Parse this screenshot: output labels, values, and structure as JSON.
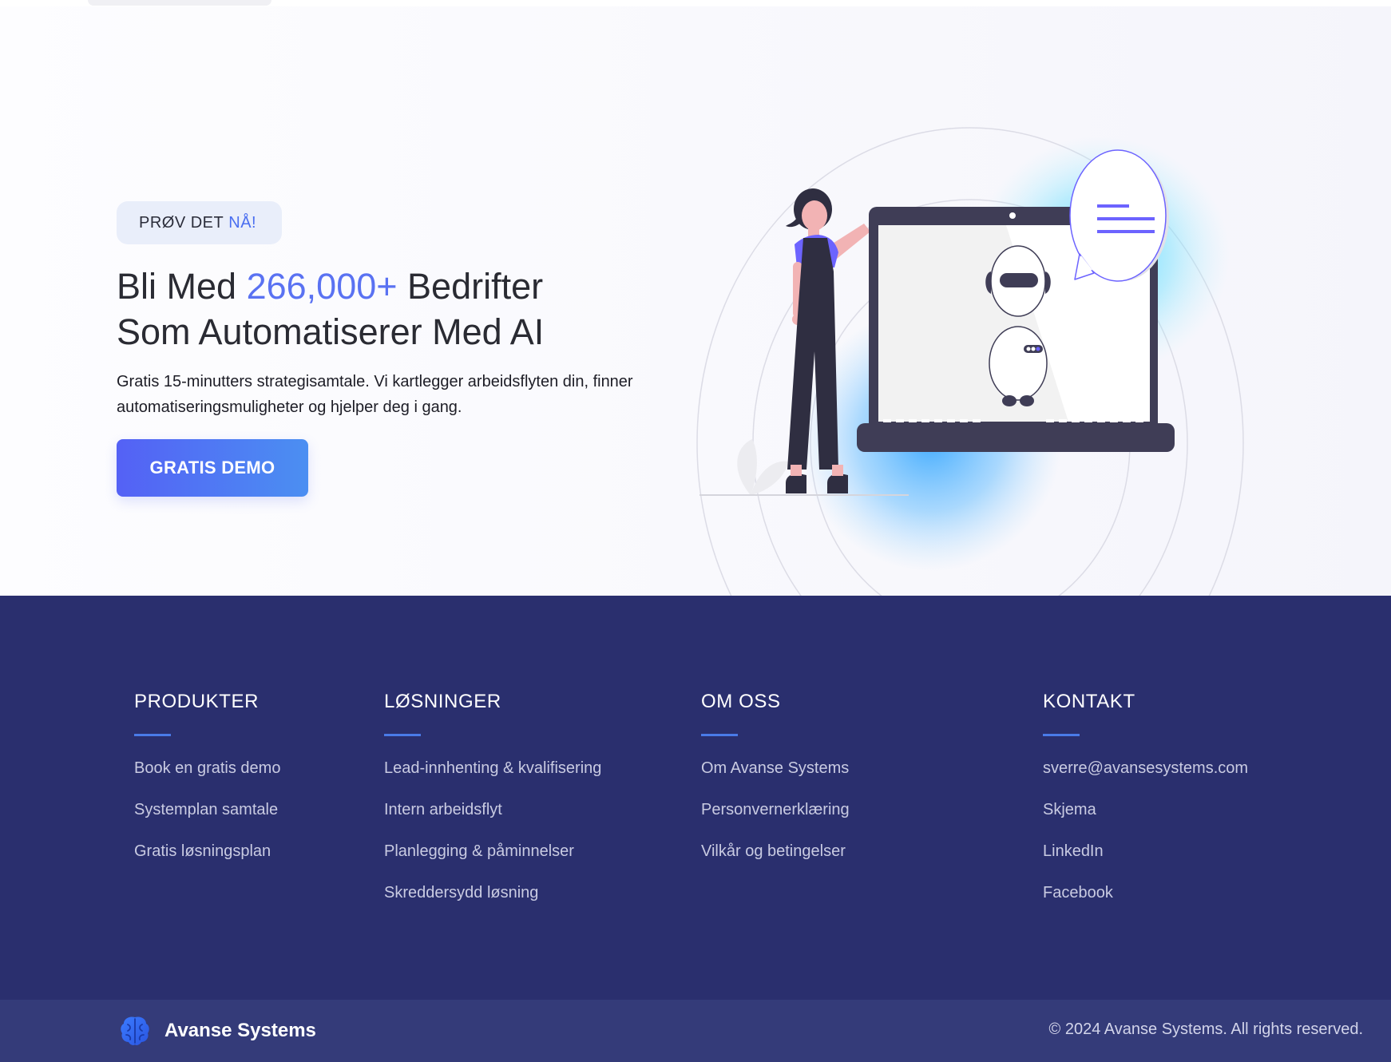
{
  "hero": {
    "badge_prefix": "PRØV DET",
    "badge_accent": "NÅ!",
    "headline_part1": "Bli Med",
    "headline_accent": "266,000+",
    "headline_part2": "Bedrifter",
    "headline_line2": "Som Automatiserer Med AI",
    "subtext": "Gratis 15-minutters strategisamtale. Vi kartlegger arbeidsflyten din, finner automatiseringsmuligheter og hjelper deg i gang.",
    "cta_label": "GRATIS DEMO",
    "illustration": "person-with-laptop-robot-illustration"
  },
  "footer": {
    "columns": [
      {
        "title": "PRODUKTER",
        "links": [
          "Book en gratis demo",
          "Systemplan samtale",
          "Gratis løsningsplan"
        ]
      },
      {
        "title": "LØSNINGER",
        "links": [
          "Lead-innhenting & kvalifisering",
          "Intern arbeidsflyt",
          "Planlegging & påminnelser",
          "Skreddersydd løsning"
        ]
      },
      {
        "title": "OM OSS",
        "links": [
          "Om Avanse Systems",
          "Personvernerklæring",
          "Vilkår og betingelser"
        ]
      },
      {
        "title": "KONTAKT",
        "links": [
          "sverre@avansesystems.com",
          "Skjema",
          "LinkedIn",
          "Facebook"
        ]
      }
    ]
  },
  "bottom": {
    "brand_name": "Avanse Systems",
    "brand_icon": "brain-logo-icon",
    "copyright": "© 2024 Avanse Systems. All rights reserved."
  },
  "colors": {
    "accent": "#5a72f2",
    "footer_bg": "#2a2f6e",
    "bottom_bar_bg": "#343b79",
    "cta_gradient_start": "#5461f5",
    "cta_gradient_end": "#4b8ff2"
  }
}
